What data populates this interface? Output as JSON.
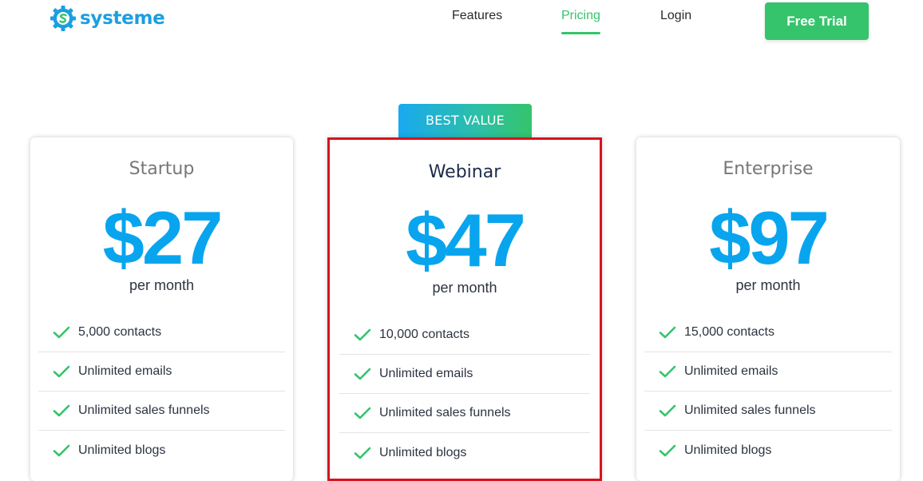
{
  "brand": {
    "name": "systeme",
    "color": "#1b9fe0"
  },
  "nav": {
    "items": [
      {
        "label": "Features",
        "active": false
      },
      {
        "label": "Pricing",
        "active": true
      },
      {
        "label": "Login",
        "active": false
      }
    ],
    "cta_label": "Free Trial",
    "accent": "#35c46b"
  },
  "badge": {
    "label": "BEST VALUE"
  },
  "plans": [
    {
      "name": "Startup",
      "price": "$27",
      "period": "per month",
      "features": [
        "5,000 contacts",
        "Unlimited emails",
        "Unlimited sales funnels",
        "Unlimited blogs"
      ]
    },
    {
      "name": "Webinar",
      "price": "$47",
      "period": "per month",
      "featured": true,
      "features": [
        "10,000 contacts",
        "Unlimited emails",
        "Unlimited sales funnels",
        "Unlimited blogs"
      ]
    },
    {
      "name": "Enterprise",
      "price": "$97",
      "period": "per month",
      "features": [
        "15,000 contacts",
        "Unlimited emails",
        "Unlimited sales funnels",
        "Unlimited blogs"
      ]
    }
  ],
  "colors": {
    "price": "#08a5ee",
    "check": "#35c46b",
    "highlight_border": "#d8121f"
  },
  "icons": {
    "logo": "gear-s-logo-icon",
    "feature": "check-icon"
  }
}
